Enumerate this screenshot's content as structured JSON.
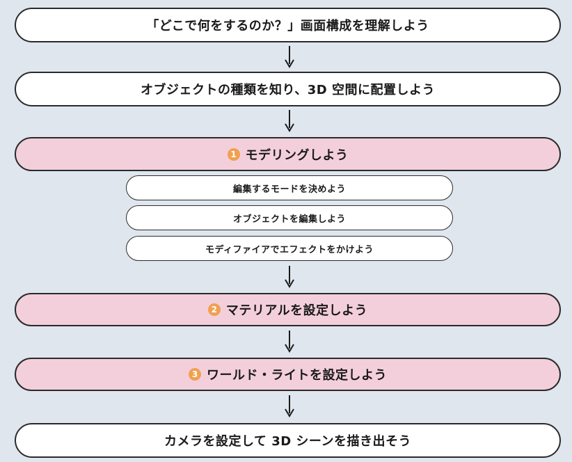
{
  "steps": {
    "step1": "「どこで何をするのか？」画面構成を理解しよう",
    "step2": "オブジェクトの種類を知り、3D 空間に配置しよう",
    "step3": {
      "num": "1",
      "label": "モデリングしよう"
    },
    "sub1": "編集するモードを決めよう",
    "sub2": "オブジェクトを編集しよう",
    "sub3": "モディファイアでエフェクトをかけよう",
    "step4": {
      "num": "2",
      "label": "マテリアルを設定しよう"
    },
    "step5": {
      "num": "3",
      "label": "ワールド・ライトを設定しよう"
    },
    "step6": "カメラを設定して 3D シーンを描き出そう"
  },
  "colors": {
    "background": "#dfe6ee",
    "box_white": "#ffffff",
    "box_pink": "#f3cfdb",
    "number_badge": "#f0a050",
    "border": "#2a2a2a"
  }
}
